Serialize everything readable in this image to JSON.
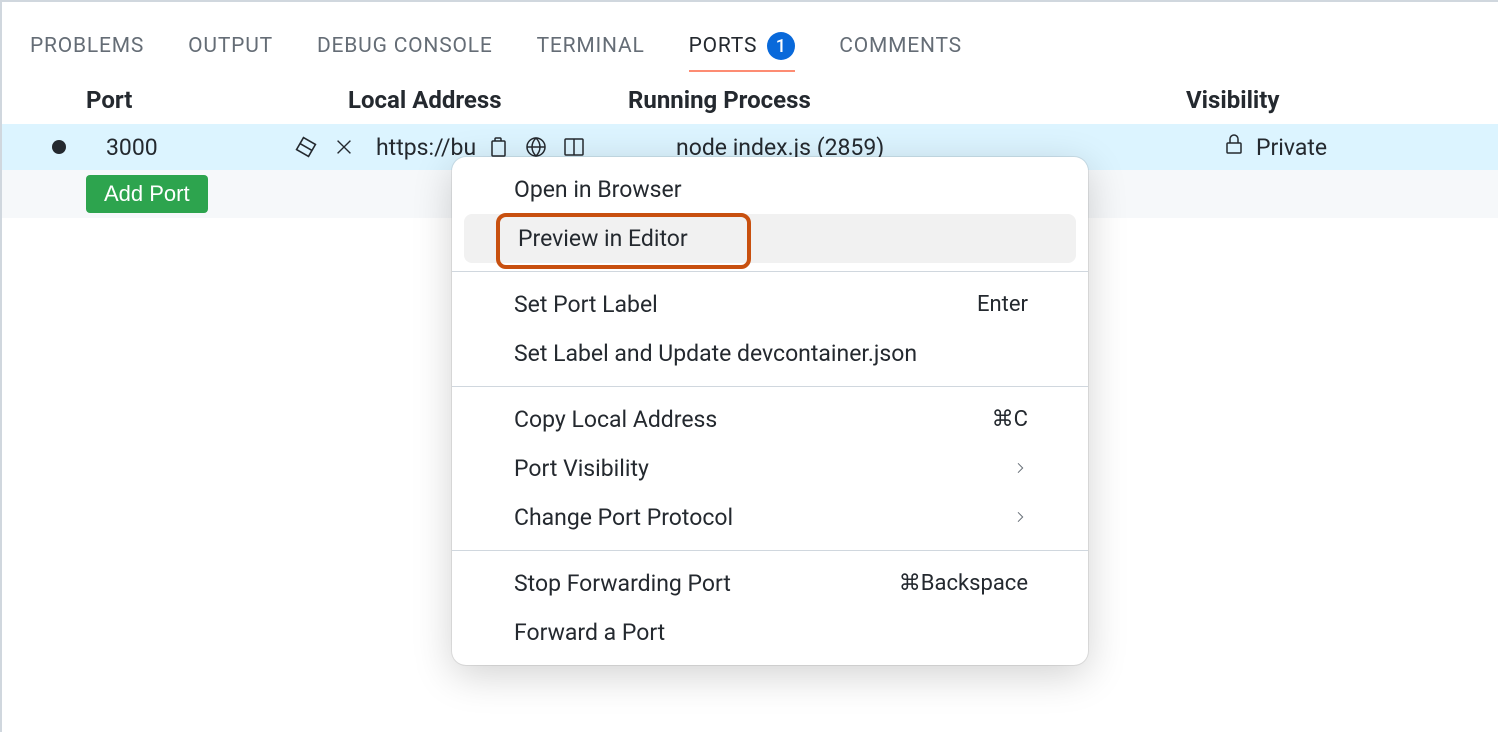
{
  "tabs": {
    "problems": "PROBLEMS",
    "output": "OUTPUT",
    "debug_console": "DEBUG CONSOLE",
    "terminal": "TERMINAL",
    "ports": "PORTS",
    "ports_badge": "1",
    "comments": "COMMENTS"
  },
  "table": {
    "headers": {
      "port": "Port",
      "local_address": "Local Address",
      "running_process": "Running Process",
      "visibility": "Visibility"
    }
  },
  "port_row": {
    "port": "3000",
    "local_address": "https://bu",
    "running_process": "node index.js (2859)",
    "visibility": "Private"
  },
  "add_port_button": "Add Port",
  "context_menu": {
    "open_in_browser": "Open in Browser",
    "preview_in_editor": "Preview in Editor",
    "set_port_label": "Set Port Label",
    "set_port_label_shortcut": "Enter",
    "set_label_update": "Set Label and Update devcontainer.json",
    "copy_local_address": "Copy Local Address",
    "copy_local_address_shortcut": "⌘C",
    "port_visibility": "Port Visibility",
    "change_port_protocol": "Change Port Protocol",
    "stop_forwarding": "Stop Forwarding Port",
    "stop_forwarding_shortcut": "⌘Backspace",
    "forward_a_port": "Forward a Port"
  }
}
